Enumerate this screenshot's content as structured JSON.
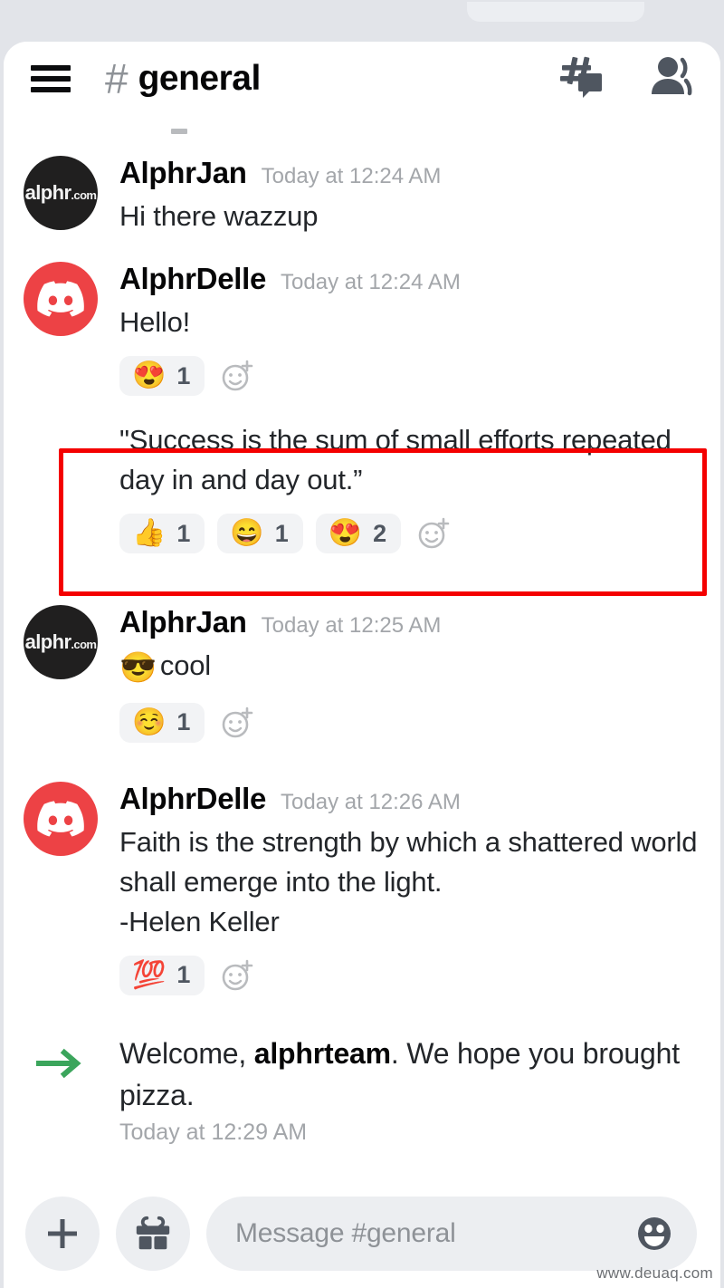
{
  "app": {
    "platform": "discord-mobile",
    "watermark": "www.deuaq.com"
  },
  "header": {
    "menu_icon": "hamburger-menu-icon",
    "hash_glyph": "#",
    "channel_name": "general",
    "threads_icon": "threads-icon",
    "members_icon": "members-icon"
  },
  "messages": [
    {
      "id": "m1",
      "avatar_type": "alphr-logo",
      "avatar_text": "alphr",
      "avatar_suffix": ".com",
      "author": "AlphrJan",
      "timestamp": "Today at 12:24 AM",
      "text": "Hi there wazzup",
      "reactions": []
    },
    {
      "id": "m2",
      "avatar_type": "discord-logo",
      "author": "AlphrDelle",
      "timestamp": "Today at 12:24 AM",
      "text": "Hello!",
      "reactions": [
        {
          "emoji": "😍",
          "name": "heart-eyes-reaction",
          "count": "1"
        }
      ],
      "add_reaction_label": "add-reaction-icon"
    },
    {
      "id": "m3",
      "highlighted": true,
      "author": "",
      "timestamp": "",
      "text": "\"Success is the sum of small efforts repeated day in and day out.”",
      "reactions": [
        {
          "emoji": "👍",
          "name": "thumbs-up-reaction",
          "count": "1"
        },
        {
          "emoji": "😄",
          "name": "grinning-smile-reaction",
          "count": "1"
        },
        {
          "emoji": "😍",
          "name": "heart-eyes-reaction",
          "count": "2"
        }
      ]
    },
    {
      "id": "m4",
      "avatar_type": "alphr-logo",
      "avatar_text": "alphr",
      "avatar_suffix": ".com",
      "author": "AlphrJan",
      "timestamp": "Today at 12:25 AM",
      "text_emoji": "😎",
      "text": "cool",
      "reactions": [
        {
          "emoji": "☺️",
          "name": "smiling-blush-reaction",
          "count": "1"
        }
      ]
    },
    {
      "id": "m5",
      "avatar_type": "discord-logo",
      "author": "AlphrDelle",
      "timestamp": "Today at 12:26 AM",
      "text": "Faith is the strength by which a shattered world shall emerge into the light.\n-Helen Keller",
      "reactions": [
        {
          "emoji": "💯",
          "name": "hundred-points-reaction",
          "count": "1"
        }
      ]
    }
  ],
  "system_message": {
    "icon": "join-arrow-icon",
    "prefix": "Welcome, ",
    "username": "alphrteam",
    "suffix": ". We hope you brought pizza.",
    "timestamp": "Today at 12:29 AM"
  },
  "composer": {
    "add_label": "+",
    "add_icon": "plus-icon",
    "gift_icon": "gift-icon",
    "placeholder": "Message #general",
    "value": "",
    "emoji_icon": "emoji-picker-icon"
  },
  "colors": {
    "brand_red": "#ed4245",
    "annotation_red": "#f40000",
    "join_green": "#3ba55c",
    "pill_gray": "#f2f3f5",
    "muted_text": "#a3a6aa",
    "icon_gray": "#4f5660"
  }
}
